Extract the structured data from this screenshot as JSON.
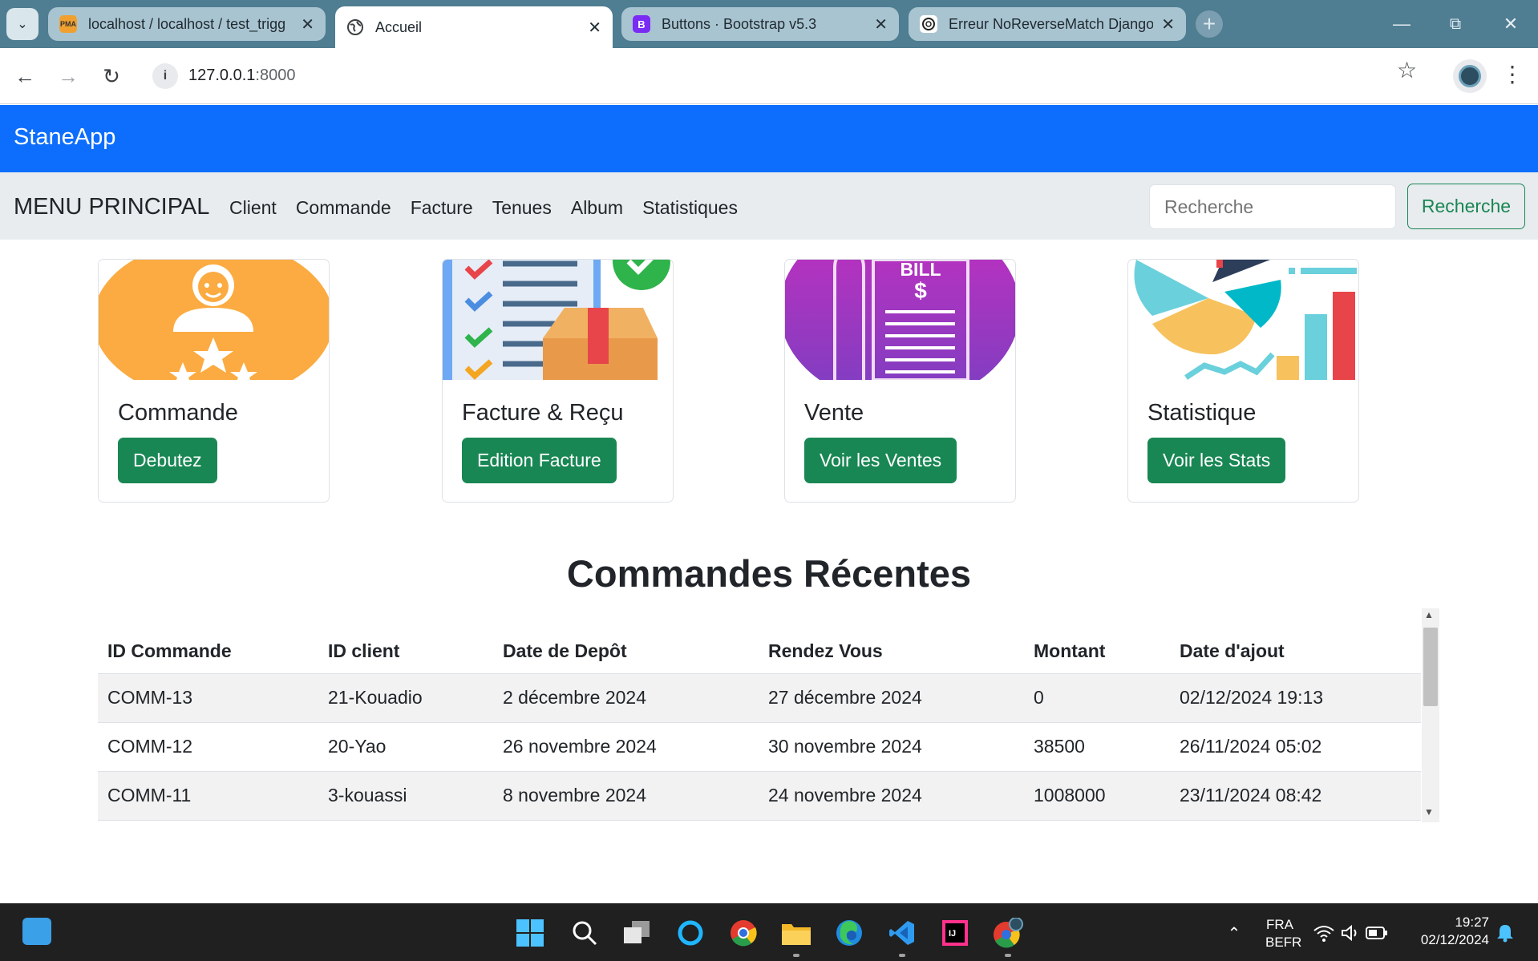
{
  "browser": {
    "tabs": [
      {
        "title": "localhost / localhost / test_trigg",
        "favicon": "phpmyadmin-icon"
      },
      {
        "title": "Accueil",
        "favicon": "globe-icon"
      },
      {
        "title": "Buttons · Bootstrap v5.3",
        "favicon": "bootstrap-icon"
      },
      {
        "title": "Erreur NoReverseMatch Django",
        "favicon": "chatgpt-icon"
      }
    ],
    "active_tab": 1,
    "url_host": "127.0.0.1",
    "url_port": ":8000",
    "favicon_labels": {
      "pma": "PMA",
      "bootstrap": "B"
    }
  },
  "app": {
    "brand": "StaneApp",
    "menu_title": "MENU PRINCIPAL",
    "menu_links": [
      "Client",
      "Commande",
      "Facture",
      "Tenues",
      "Album",
      "Statistiques"
    ],
    "search_placeholder": "Recherche",
    "search_button": "Recherche"
  },
  "cards": [
    {
      "title": "Commande",
      "button": "Debutez",
      "image": "customer-rating-illustration"
    },
    {
      "title": "Facture & Reçu",
      "button": "Edition Facture",
      "image": "checklist-package-illustration"
    },
    {
      "title": "Vente",
      "button": "Voir les Ventes",
      "image": "bill-illustration",
      "image_text": "BILL"
    },
    {
      "title": "Statistique",
      "button": "Voir les Stats",
      "image": "statistics-illustration"
    }
  ],
  "recent_orders": {
    "title": "Commandes Récentes",
    "headers": [
      "ID Commande",
      "ID client",
      "Date de Depôt",
      "Rendez Vous",
      "Montant",
      "Date d'ajout"
    ],
    "rows": [
      [
        "COMM-13",
        "21-Kouadio",
        "2 décembre 2024",
        "27 décembre 2024",
        "0",
        "02/12/2024 19:13"
      ],
      [
        "COMM-12",
        "20-Yao",
        "26 novembre 2024",
        "30 novembre 2024",
        "38500",
        "26/11/2024 05:02"
      ],
      [
        "COMM-11",
        "3-kouassi",
        "8 novembre 2024",
        "24 novembre 2024",
        "1008000",
        "23/11/2024 08:42"
      ]
    ]
  },
  "taskbar": {
    "language": "FRA",
    "layout": "BEFR",
    "time": "19:27",
    "date": "02/12/2024"
  },
  "colors": {
    "primary": "#0d6efd",
    "success": "#198754",
    "menu_bg": "#e9ecef"
  }
}
